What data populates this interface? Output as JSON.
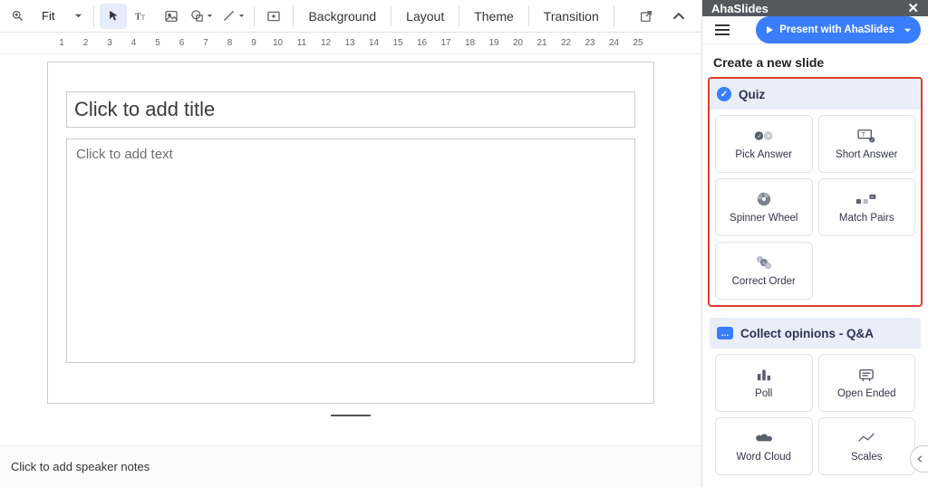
{
  "toolbar": {
    "zoom_label": "Fit",
    "background": "Background",
    "layout": "Layout",
    "theme": "Theme",
    "transition": "Transition"
  },
  "ruler": {
    "ticks": [
      1,
      2,
      3,
      4,
      5,
      6,
      7,
      8,
      9,
      10,
      11,
      12,
      13,
      14,
      15,
      16,
      17,
      18,
      19,
      20,
      21,
      22,
      23,
      24,
      25
    ]
  },
  "slide": {
    "title_placeholder": "Click to add title",
    "body_placeholder": "Click to add text"
  },
  "notes": {
    "placeholder": "Click to add speaker notes"
  },
  "sidebar": {
    "app_title": "AhaSlides",
    "present_label": "Present with AhaSlides",
    "create_heading": "Create a new slide",
    "quiz": {
      "heading": "Quiz",
      "tiles": {
        "pick_answer": "Pick Answer",
        "short_answer": "Short Answer",
        "spinner_wheel": "Spinner Wheel",
        "match_pairs": "Match Pairs",
        "correct_order": "Correct Order"
      }
    },
    "opinions": {
      "heading": "Collect opinions - Q&A",
      "tiles": {
        "poll": "Poll",
        "open_ended": "Open Ended",
        "word_cloud": "Word Cloud",
        "scales": "Scales"
      }
    }
  }
}
